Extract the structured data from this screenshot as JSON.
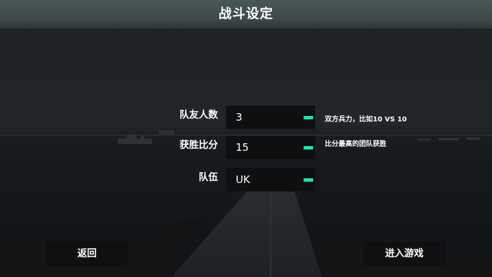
{
  "header": {
    "title": "战斗设定"
  },
  "settings": {
    "rows": [
      {
        "label": "队友人数",
        "value": "3",
        "hint": "双方兵力，比如10 VS 10"
      },
      {
        "label": "获胜比分",
        "value": "15",
        "hint": "比分最高的团队获胜"
      },
      {
        "label": "队伍",
        "value": "UK",
        "hint": ""
      }
    ]
  },
  "footer": {
    "back_label": "返回",
    "start_label": "进入游戏"
  },
  "colors": {
    "accent": "#22e3a5",
    "topbar": "#4a5759",
    "background": "#141619"
  }
}
